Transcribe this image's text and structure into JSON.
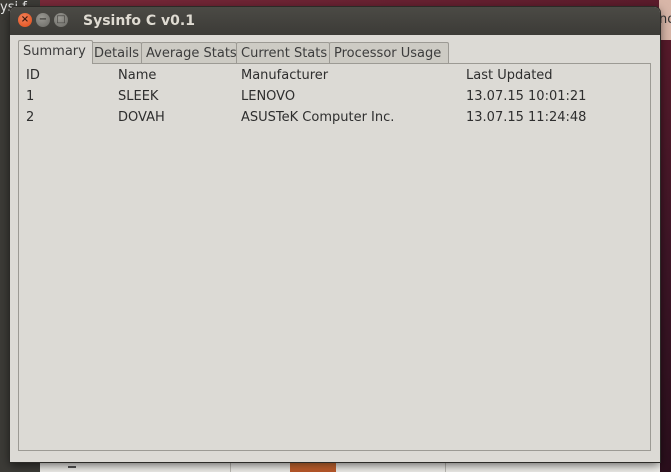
{
  "desktop": {
    "bg_text": "ysi f",
    "bg_right_text": "no"
  },
  "window": {
    "title": "Sysinfo C v0.1",
    "controls": {
      "close": "×",
      "minimize": "−",
      "maximize": "□"
    }
  },
  "tabs": [
    {
      "label": "Summary",
      "active": true
    },
    {
      "label": "Details",
      "active": false
    },
    {
      "label": "Average Stats",
      "active": false
    },
    {
      "label": "Current Stats",
      "active": false
    },
    {
      "label": "Processor Usage",
      "active": false
    }
  ],
  "table": {
    "columns": [
      "ID",
      "Name",
      "Manufacturer",
      "Last Updated"
    ],
    "rows": [
      [
        "1",
        "SLEEK",
        "LENOVO",
        "13.07.15 10:01:21"
      ],
      [
        "2",
        "DOVAH",
        "ASUSTeK Computer Inc.",
        "13.07.15 11:24:48"
      ]
    ]
  }
}
